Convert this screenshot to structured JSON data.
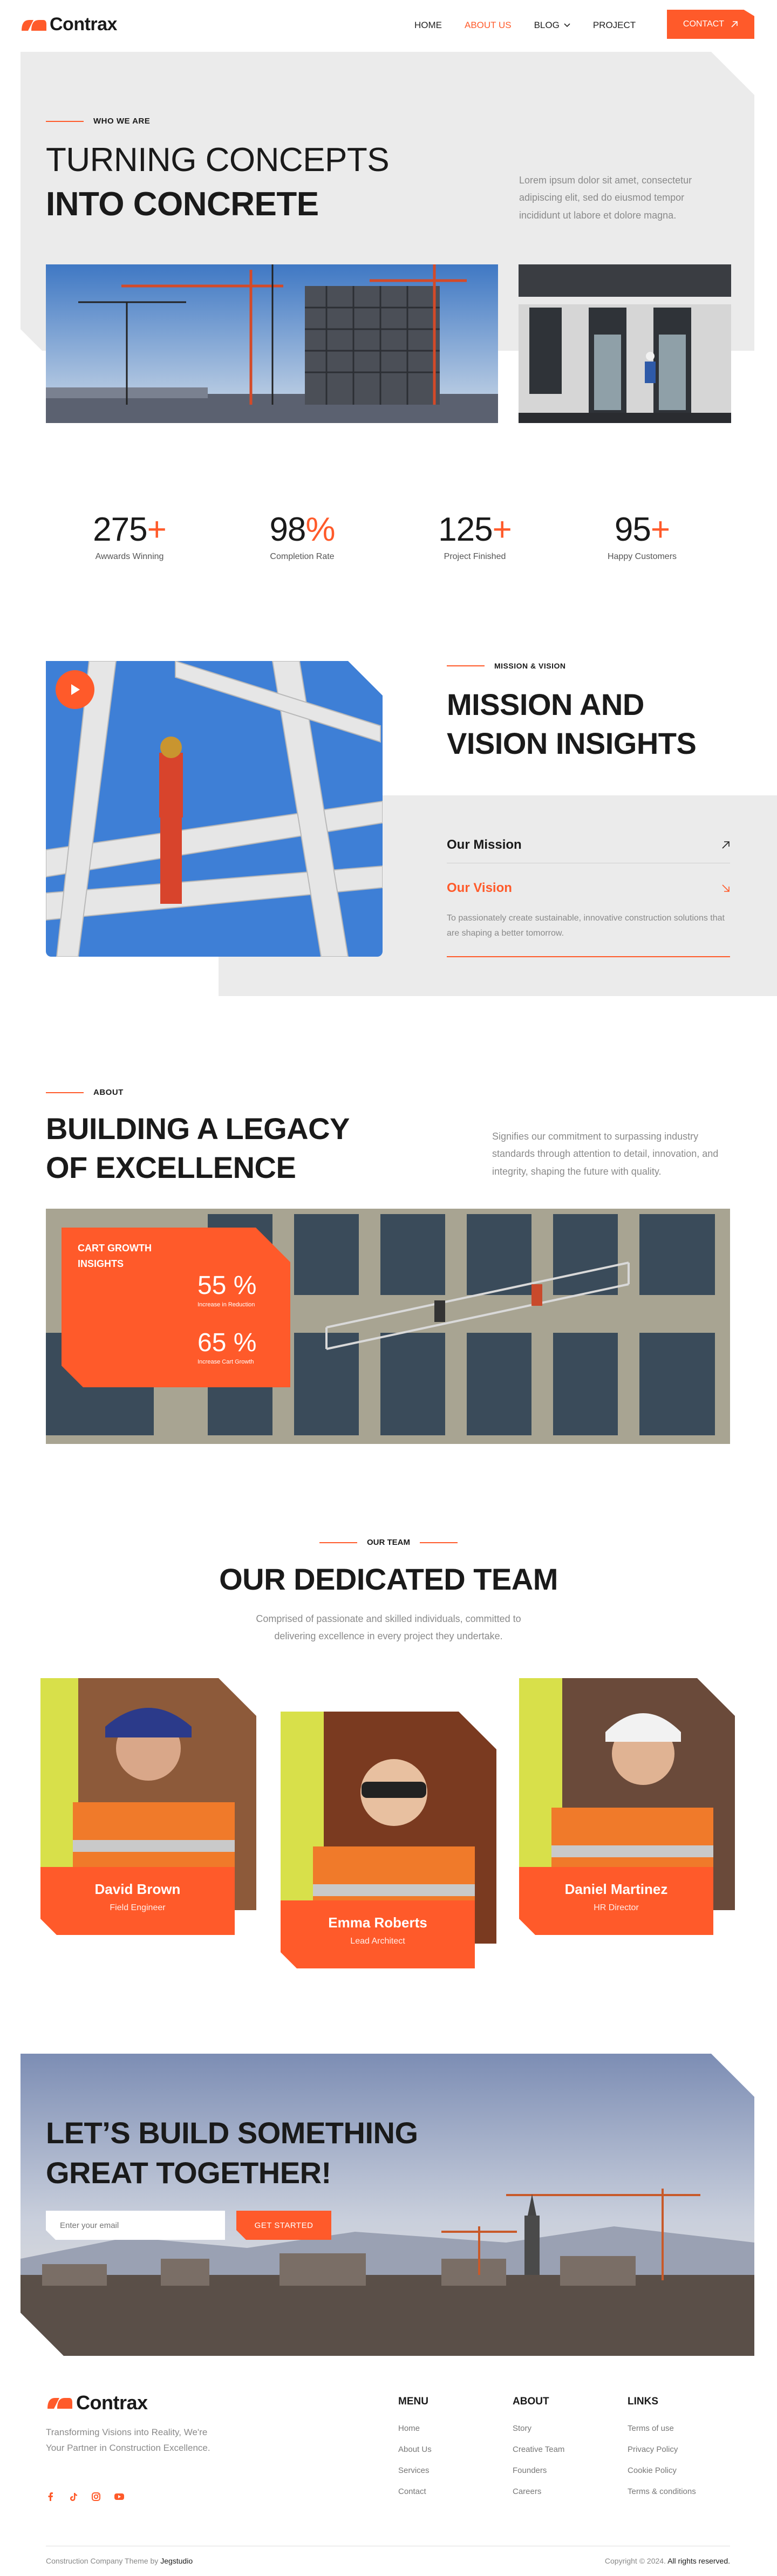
{
  "header": {
    "logo_text": "Contrax",
    "nav": [
      {
        "label": "HOME"
      },
      {
        "label": "ABOUT US",
        "active": true
      },
      {
        "label": "BLOG"
      },
      {
        "label": "PROJECT"
      }
    ],
    "contact_label": "CONTACT"
  },
  "hero": {
    "eyebrow": "WHO WE ARE",
    "title_line1": "TURNING CONCEPTS",
    "title_line2": "INTO CONCRETE",
    "description": "Lorem ipsum dolor sit amet, consectetur adipiscing elit, sed do eiusmod tempor incididunt ut labore et dolore magna."
  },
  "stats": [
    {
      "value": "275",
      "suffix": "+",
      "label": "Awwards Winning"
    },
    {
      "value": "98",
      "suffix": "%",
      "label": "Completion Rate"
    },
    {
      "value": "125",
      "suffix": "+",
      "label": "Project Finished"
    },
    {
      "value": "95",
      "suffix": "+",
      "label": "Happy Customers"
    }
  ],
  "mission": {
    "eyebrow": "MISSION & VISION",
    "title_line1": "MISSION AND",
    "title_line2": "VISION INSIGHTS",
    "tab_mission": "Our Mission",
    "tab_vision": "Our Vision",
    "vision_text": "To passionately create sustainable, innovative construction solutions that are shaping a better tomorrow."
  },
  "about": {
    "eyebrow": "ABOUT",
    "title_line1": "BUILDING A LEGACY",
    "title_line2": "OF EXCELLENCE",
    "description": "Signifies our commitment to surpassing industry standards through attention to detail, innovation, and integrity, shaping the future with quality.",
    "card_title_line1": "CART GROWTH",
    "card_title_line2": "INSIGHTS",
    "metric1_value": "55 %",
    "metric1_label": "Increase in Reduction",
    "metric2_value": "65 %",
    "metric2_label": "Increase Cart Growth"
  },
  "team": {
    "eyebrow": "OUR TEAM",
    "title": "OUR DEDICATED TEAM",
    "description_line1": "Comprised of passionate and skilled individuals, committed to",
    "description_line2": "delivering excellence in every project they undertake.",
    "members": [
      {
        "name": "David Brown",
        "role": "Field Engineer"
      },
      {
        "name": "Emma Roberts",
        "role": "Lead Architect"
      },
      {
        "name": "Daniel Martinez",
        "role": "HR Director"
      }
    ]
  },
  "cta": {
    "title_line1": "LET’S BUILD SOMETHING",
    "title_line2": "GREAT TOGETHER!",
    "email_placeholder": "Enter your email",
    "button_label": "GET STARTED"
  },
  "footer": {
    "logo_text": "Contrax",
    "tagline_line1": "Transforming Visions into Reality, We're",
    "tagline_line2": "Your Partner in Construction Excellence.",
    "columns": [
      {
        "title": "MENU",
        "links": [
          "Home",
          "About Us",
          "Services",
          "Contact"
        ]
      },
      {
        "title": "ABOUT",
        "links": [
          "Story",
          "Creative Team",
          "Founders",
          "Careers"
        ]
      },
      {
        "title": "LINKS",
        "links": [
          "Terms of use",
          "Privacy Policy",
          "Cookie Policy",
          "Terms & conditions"
        ]
      }
    ],
    "credit_prefix": "Construction Company Theme by",
    "credit_brand": "Jegstudio",
    "copyright_prefix": "Copyright © 2024.",
    "copyright_suffix": "All rights reserved."
  },
  "colors": {
    "accent": "#ff5a2a",
    "panel_gray": "#ebebeb",
    "text_dark": "#1a1a1a"
  }
}
